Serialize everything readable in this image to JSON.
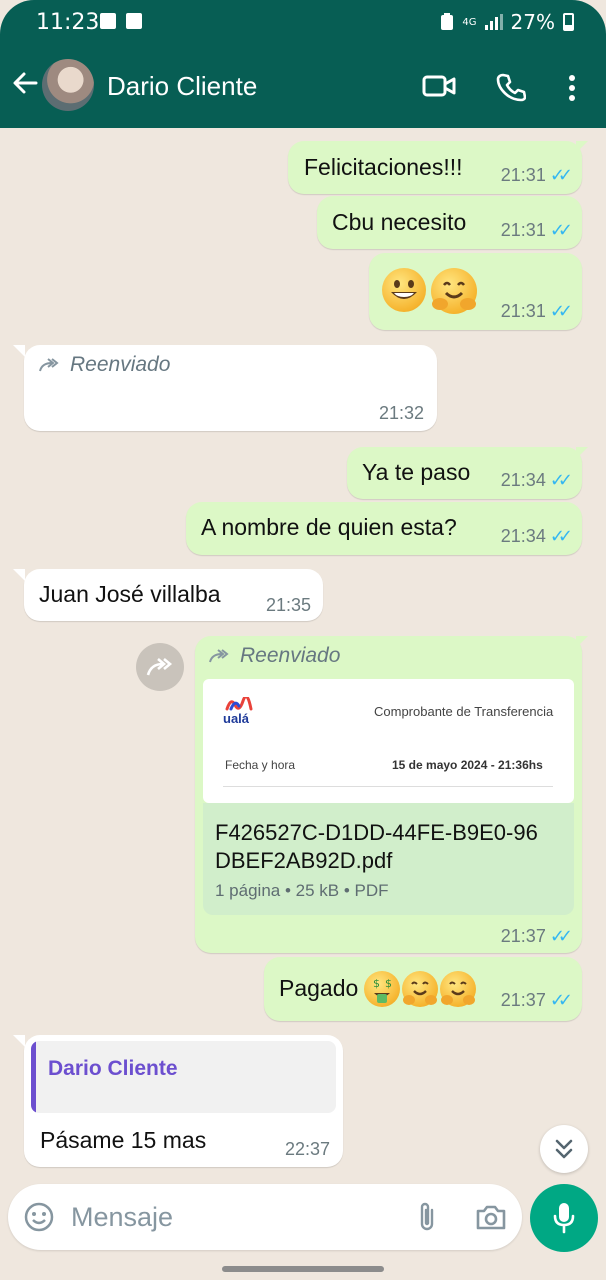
{
  "status_bar": {
    "time": "11:23",
    "network": "4G",
    "battery": "27%"
  },
  "header": {
    "contact_name": "Dario Cliente"
  },
  "messages": [
    {
      "type": "outgoing",
      "text": "Felicitaciones!!!",
      "time": "21:31"
    },
    {
      "type": "outgoing",
      "text": "Cbu necesito",
      "time": "21:31"
    },
    {
      "type": "outgoing",
      "emoji": [
        "grinning-face",
        "hugging-face"
      ],
      "time": "21:31"
    },
    {
      "type": "incoming",
      "forwarded_label": "Reenviado",
      "time": "21:32"
    },
    {
      "type": "outgoing",
      "text": "Ya te paso",
      "time": "21:34"
    },
    {
      "type": "outgoing",
      "text": "A nombre de quien esta?",
      "time": "21:34"
    },
    {
      "type": "incoming",
      "text": "Juan José villalba",
      "time": "21:35"
    },
    {
      "type": "outgoing",
      "forwarded_label": "Reenviado",
      "document": {
        "brand": "ualá",
        "preview_title": "Comprobante de Transferencia",
        "date_label": "Fecha y hora",
        "date_value": "15 de mayo 2024 - 21:36hs",
        "filename_line1": "F426527C-D1DD-44FE-B9E0-96",
        "filename_line2": "DBEF2AB92D.pdf",
        "details": "1 página • 25 kB • PDF"
      },
      "time": "21:37"
    },
    {
      "type": "outgoing",
      "text": "Pagado",
      "emoji": [
        "money-mouth-face",
        "hugging-face",
        "hugging-face"
      ],
      "time": "21:37"
    },
    {
      "type": "incoming",
      "quoted_author": "Dario Cliente",
      "text": "Pásame 15 mas",
      "time": "22:37"
    }
  ],
  "composer": {
    "placeholder": "Mensaje"
  },
  "colors": {
    "header": "#075e54",
    "outgoing_bubble": "#dcf8c6",
    "incoming_bubble": "#ffffff",
    "read_ticks": "#34b7f1",
    "mic_button": "#00a884",
    "quote_accent": "#6c4fcf"
  }
}
